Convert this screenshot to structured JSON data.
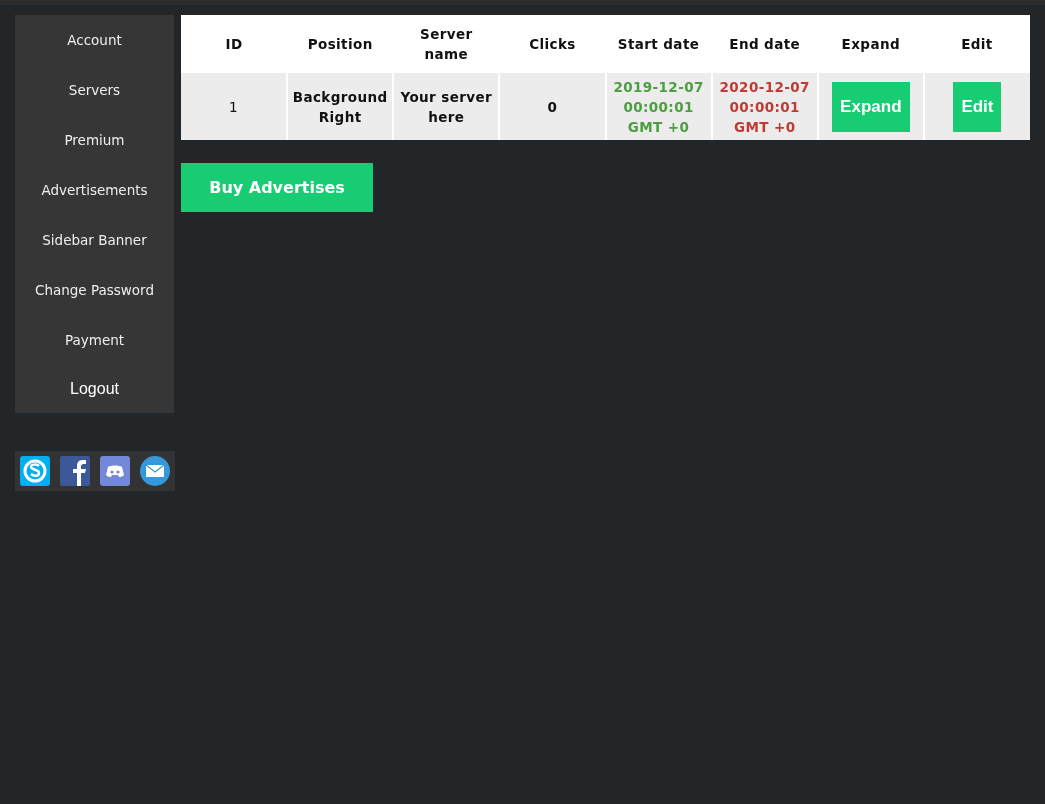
{
  "sidebar": {
    "items": [
      {
        "label": "Account",
        "kind": "link"
      },
      {
        "label": "Servers",
        "kind": "link"
      },
      {
        "label": "Premium",
        "kind": "link"
      },
      {
        "label": "Advertisements",
        "kind": "link"
      },
      {
        "label": "Sidebar Banner",
        "kind": "link"
      },
      {
        "label": "Change Password",
        "kind": "link"
      },
      {
        "label": "Payment",
        "kind": "link"
      },
      {
        "label": "Logout",
        "kind": "logout"
      }
    ],
    "social": [
      {
        "kind": "chat"
      },
      {
        "kind": "facebook"
      },
      {
        "kind": "discord"
      },
      {
        "kind": "mail"
      }
    ]
  },
  "table": {
    "columns": [
      {
        "label": "ID"
      },
      {
        "label": "Position"
      },
      {
        "label": "Server name"
      },
      {
        "label": "Clicks"
      },
      {
        "label": "Start date"
      },
      {
        "label": "End date"
      },
      {
        "label": "Expand"
      },
      {
        "label": "Edit"
      }
    ],
    "rows": [
      {
        "cells": [
          {
            "kind": "plain",
            "lines": [
              "1"
            ]
          },
          {
            "kind": "bold",
            "lines": [
              "Background",
              "Right"
            ]
          },
          {
            "kind": "bold",
            "lines": [
              "Your server",
              "here"
            ]
          },
          {
            "kind": "bold",
            "lines": [
              "0"
            ]
          },
          {
            "kind": "date",
            "lines": [
              "2019-12-07",
              "00:00:01",
              "GMT +0"
            ],
            "color": "#4a9f3f"
          },
          {
            "kind": "date",
            "lines": [
              "2020-12-07",
              "00:00:01",
              "GMT +0"
            ],
            "color": "#c03a32"
          },
          {
            "kind": "button",
            "lines": [
              "Expand"
            ]
          },
          {
            "kind": "button",
            "lines": [
              "Edit"
            ]
          }
        ]
      }
    ]
  },
  "buy_button": {
    "label": "Buy Advertises"
  }
}
